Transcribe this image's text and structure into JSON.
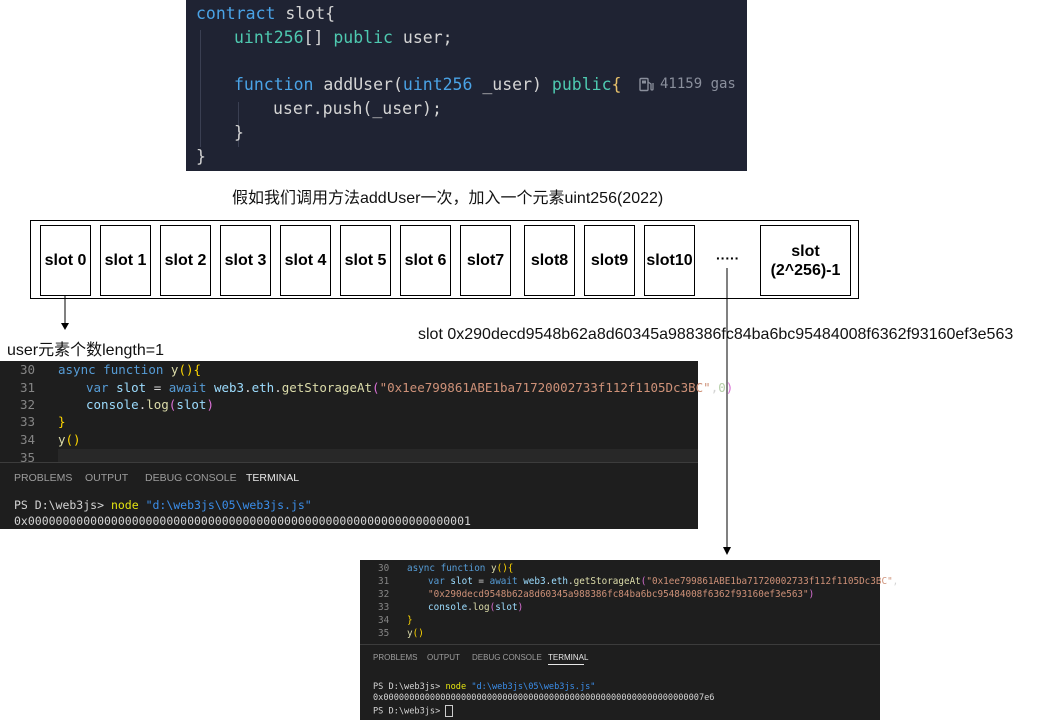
{
  "solidity": {
    "line1": [
      "contract",
      " slot{"
    ],
    "line2": [
      "uint256",
      "[] ",
      "public",
      " user;"
    ],
    "line3": [
      "function",
      " addUser(",
      "uint256",
      " _user) ",
      "public",
      "{"
    ],
    "line4": "user.push(_user);",
    "line5": "}",
    "line6": "}",
    "gas": "41159 gas"
  },
  "caption": "假如我们调用方法addUser一次，加入一个元素uint256(2022)",
  "slots": [
    "slot 0",
    "slot 1",
    "slot 2",
    "slot 3",
    "slot 4",
    "slot 5",
    "slot 6",
    "slot7",
    "slot8",
    "slot9",
    "slot10"
  ],
  "ellipsis": "·····",
  "last_slot": [
    "slot",
    "(2^256)-1"
  ],
  "note_length": "user元素个数length=1",
  "note_slot": "slot 0x290decd9548b62a8d60345a988386fc84ba6bc95484008f6362f93160ef3e563",
  "panel1": {
    "line_numbers": [
      "30",
      "31",
      "32",
      "33",
      "34",
      "35"
    ],
    "code": {
      "l30": [
        "async",
        " ",
        "function",
        " ",
        "y",
        "(){"
      ],
      "l31": [
        "var",
        " ",
        "slot",
        " = ",
        "await",
        " ",
        "web3",
        ".",
        "eth",
        ".",
        "getStorageAt",
        "(",
        "\"0x1ee799861ABE1ba71720002733f112f1105Dc3BC\"",
        ",",
        "0",
        ")"
      ],
      "l32": [
        "console",
        ".",
        "log",
        "(",
        "slot",
        ")"
      ],
      "l33": "}",
      "l34": [
        "y",
        "()"
      ]
    },
    "tabs": [
      "PROBLEMS",
      "OUTPUT",
      "DEBUG CONSOLE",
      "TERMINAL"
    ],
    "terminal_cmd": [
      "PS D:\\web3js>",
      " node ",
      "\"d:\\web3js\\05\\web3js.js\""
    ],
    "terminal_out": "0x0000000000000000000000000000000000000000000000000000000000000001"
  },
  "panel2": {
    "line_numbers": [
      "30",
      "31",
      "32",
      "33",
      "34",
      "35"
    ],
    "code": {
      "l30": [
        "async",
        " ",
        "function",
        " ",
        "y",
        "(){"
      ],
      "l31": [
        "var",
        " ",
        "slot",
        " = ",
        "await",
        " ",
        "web3",
        ".",
        "eth",
        ".",
        "getStorageAt",
        "(",
        "\"0x1ee799861ABE1ba71720002733f112f1105Dc3BC\"",
        ","
      ],
      "l32": [
        "\"0x290decd9548b62a8d60345a988386fc84ba6bc95484008f6362f93160ef3e563\"",
        ")"
      ],
      "l33": [
        "console",
        ".",
        "log",
        "(",
        "slot",
        ")"
      ],
      "l34": "}",
      "l35": [
        "y",
        "()"
      ]
    },
    "tabs": [
      "PROBLEMS",
      "OUTPUT",
      "DEBUG CONSOLE",
      "TERMINAL"
    ],
    "terminal_cmd": [
      "PS D:\\web3js>",
      " node ",
      "\"d:\\web3js\\05\\web3js.js\""
    ],
    "terminal_out": "0x00000000000000000000000000000000000000000000000000000000000007e6",
    "terminal_prompt": "PS D:\\web3js>"
  }
}
